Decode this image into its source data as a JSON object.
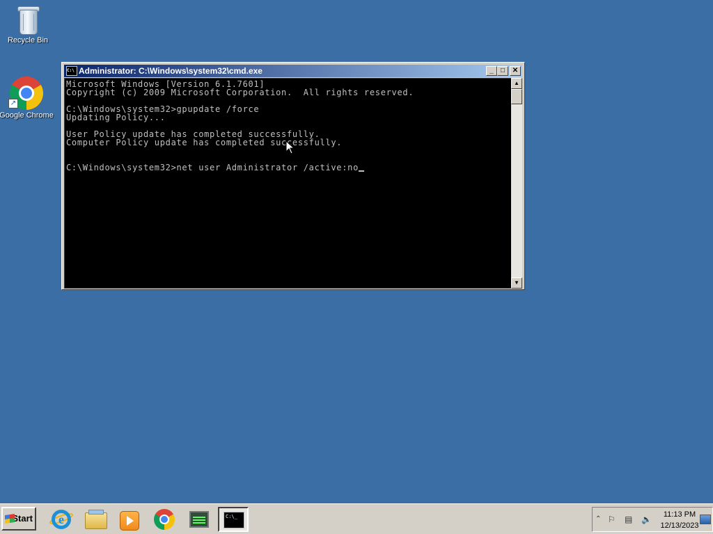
{
  "desktop": {
    "background_color": "#3a6ea5",
    "icons": [
      {
        "label": "Recycle Bin",
        "icon": "recycle-bin-icon"
      },
      {
        "label": "Google Chrome",
        "icon": "chrome-icon"
      }
    ]
  },
  "cmd_window": {
    "title": "Administrator: C:\\Windows\\system32\\cmd.exe",
    "console_lines": "Microsoft Windows [Version 6.1.7601]\nCopyright (c) 2009 Microsoft Corporation.  All rights reserved.\n\nC:\\Windows\\system32>gpupdate /force\nUpdating Policy...\n\nUser Policy update has completed successfully.\nComputer Policy update has completed successfully.\n\n\nC:\\Windows\\system32>net user Administrator /active:no",
    "buttons": {
      "minimize": "_",
      "maximize": "□",
      "close": "✕"
    }
  },
  "taskbar": {
    "start_label": "Start",
    "pinned": [
      {
        "name": "Internet Explorer",
        "icon": "ie-icon"
      },
      {
        "name": "Windows Explorer",
        "icon": "folder-icon"
      },
      {
        "name": "Windows Media Player",
        "icon": "media-player-icon"
      },
      {
        "name": "Google Chrome",
        "icon": "chrome-icon"
      },
      {
        "name": "Task Manager",
        "icon": "task-manager-icon"
      },
      {
        "name": "Command Prompt",
        "icon": "cmd-icon",
        "active": true
      }
    ],
    "cmd_icon_text": "C:\\_",
    "tray": {
      "time": "11:13 PM",
      "date": "12/13/2023",
      "icons": [
        "expand-icon",
        "action-center-flag-icon",
        "network-icon",
        "volume-icon"
      ]
    }
  }
}
